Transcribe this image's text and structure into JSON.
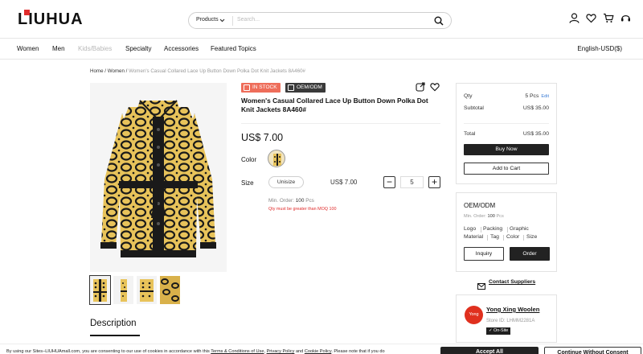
{
  "header": {
    "logo": "LIUHUA",
    "search_category": "Products",
    "search_placeholder": "Search...",
    "icons": [
      "user-icon",
      "heart-icon",
      "cart-icon",
      "support-icon"
    ]
  },
  "nav": {
    "items": [
      "Women",
      "Men",
      "Kids/Babies",
      "Specialty",
      "Accessories",
      "Featured Topics"
    ],
    "language": "English-USD($)"
  },
  "breadcrumb": {
    "home": "Home",
    "sep": "/",
    "category": "Women",
    "current": "Women's Casual Collared Lace Up Button Down Polka Dot Knit Jackets 8A460#"
  },
  "product": {
    "badge_stock": "IN STOCK",
    "badge_oem": "OEM/ODM",
    "title": "Women's Casual Collared Lace Up Button Down Polka Dot Knit Jackets 8A460#",
    "price": "US$ 7.00",
    "color_label": "Color",
    "size_label": "Size",
    "size_value": "Unisize",
    "size_price": "US$ 7.00",
    "qty_minus": "−",
    "qty_value": "5",
    "qty_plus": "+",
    "min_order_label": "Min. Order:",
    "min_order_value": "100",
    "min_order_unit": "Pcs",
    "warning": "Qty must be greater than MOQ 100",
    "description_title": "Description",
    "colors": {
      "yellow": "#e8c35a",
      "black": "#1a1a1a",
      "warn": "#e02b2b"
    }
  },
  "order_panel": {
    "qty_label": "Qty",
    "qty_value": "5 Pcs",
    "edit": "Edit",
    "subtotal_label": "Subtotal",
    "subtotal_value": "US$ 35.00",
    "total_label": "Total",
    "total_value": "US$ 35.00",
    "buy_now": "Buy Now",
    "add_to_cart": "Add to Cart"
  },
  "oem_panel": {
    "title": "OEM/ODM",
    "min_order_label": "Min. Order:",
    "min_order_value": "100",
    "min_order_unit": "Pcs",
    "options_row1": [
      "Logo",
      "Packing",
      "Graphic"
    ],
    "options_row2": [
      "Material",
      "Tag",
      "Color",
      "Size"
    ],
    "inquiry": "Inquiry",
    "order": "Order"
  },
  "contact": {
    "label": "Contact Suppliers"
  },
  "supplier": {
    "avatar_text": "Yong",
    "name": "Yong Xing Woolen",
    "store_id": "Store ID: LHMM2281A",
    "badge": "On-Site"
  },
  "cookie": {
    "text_prefix": "By using our Sites–LIUHUAmall.com, you are consenting to our use of cookies in accordance with this ",
    "link1": "Terms & Conditions of Use",
    "comma": ", ",
    "link2": "Privacy Policy",
    "and": " and ",
    "link3": "Cookie Policy",
    "text_suffix": ". Please note that if you do",
    "accept_all": "Accept All",
    "continue_without": "Continue Without Consent"
  }
}
